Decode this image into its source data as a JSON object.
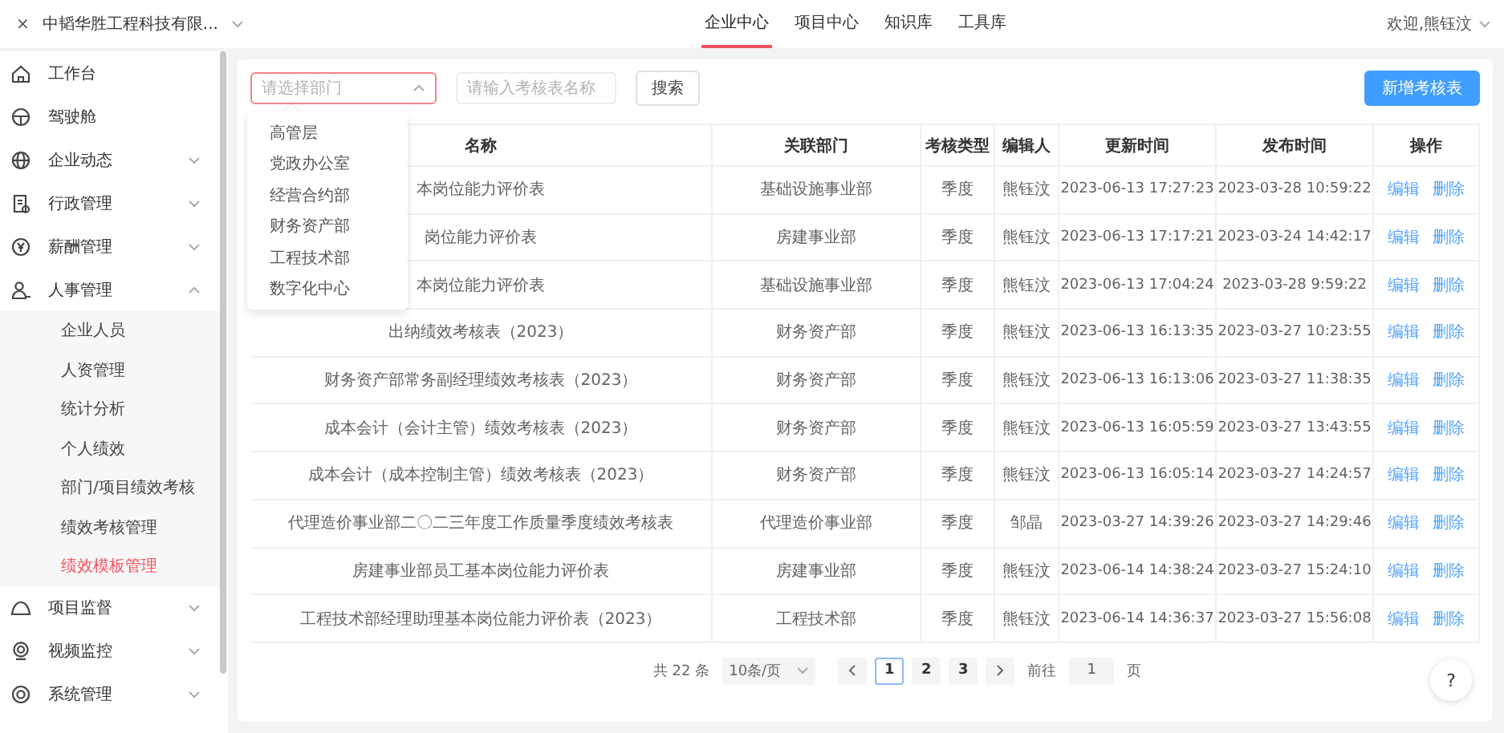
{
  "header": {
    "close": "×",
    "company": "中韬华胜工程科技有限...",
    "nav": [
      {
        "label": "企业中心",
        "selected": true
      },
      {
        "label": "项目中心",
        "selected": false
      },
      {
        "label": "知识库",
        "selected": false
      },
      {
        "label": "工具库",
        "selected": false
      }
    ],
    "user": "欢迎,熊钰汶"
  },
  "sidebar": {
    "items": [
      {
        "label": "工作台",
        "kind": "link"
      },
      {
        "label": "驾驶舱",
        "kind": "link"
      },
      {
        "label": "企业动态",
        "kind": "group",
        "expanded": false
      },
      {
        "label": "行政管理",
        "kind": "group",
        "expanded": false
      },
      {
        "label": "薪酬管理",
        "kind": "group",
        "expanded": false
      },
      {
        "label": "人事管理",
        "kind": "group",
        "expanded": true,
        "children": [
          {
            "label": "企业人员",
            "selected": false
          },
          {
            "label": "人资管理",
            "selected": false
          },
          {
            "label": "统计分析",
            "selected": false
          },
          {
            "label": "个人绩效",
            "selected": false
          },
          {
            "label": "部门/项目绩效考核",
            "selected": false
          },
          {
            "label": "绩效考核管理",
            "selected": false
          },
          {
            "label": "绩效模板管理",
            "selected": true
          }
        ]
      },
      {
        "label": "项目监督",
        "kind": "group",
        "expanded": false
      },
      {
        "label": "视频监控",
        "kind": "group",
        "expanded": false
      },
      {
        "label": "系统管理",
        "kind": "group",
        "expanded": false
      }
    ]
  },
  "filters": {
    "department": {
      "placeholder": "请选择部门",
      "expanded": true,
      "options": [
        "高管层",
        "党政办公室",
        "经营合约部",
        "财务资产部",
        "工程技术部",
        "数字化中心"
      ]
    },
    "name": {
      "placeholder": "请输入考核表名称"
    },
    "search_button": "搜索",
    "add_button": "新增考核表"
  },
  "table": {
    "columns": [
      "名称",
      "关联部门",
      "考核类型",
      "编辑人",
      "更新时间",
      "发布时间",
      "操作"
    ],
    "rows": [
      {
        "name": "本岗位能力评价表",
        "department": "基础设施事业部",
        "type": "季度",
        "editor": "熊钰汶",
        "updated": "2023-06-13 17:27:23",
        "published": "2023-03-28 10:59:22",
        "actions": [
          "编辑",
          "删除"
        ]
      },
      {
        "name": "岗位能力评价表",
        "department": "房建事业部",
        "type": "季度",
        "editor": "熊钰汶",
        "updated": "2023-06-13 17:17:21",
        "published": "2023-03-24 14:42:17",
        "actions": [
          "编辑",
          "删除"
        ]
      },
      {
        "name": "本岗位能力评价表",
        "department": "基础设施事业部",
        "type": "季度",
        "editor": "熊钰汶",
        "updated": "2023-06-13 17:04:24",
        "published": "2023-03-28 9:59:22",
        "actions": [
          "编辑",
          "删除"
        ]
      },
      {
        "name": "出纳绩效考核表（2023）",
        "department": "财务资产部",
        "type": "季度",
        "editor": "熊钰汶",
        "updated": "2023-06-13 16:13:35",
        "published": "2023-03-27 10:23:55",
        "actions": [
          "编辑",
          "删除"
        ]
      },
      {
        "name": "财务资产部常务副经理绩效考核表（2023）",
        "department": "财务资产部",
        "type": "季度",
        "editor": "熊钰汶",
        "updated": "2023-06-13 16:13:06",
        "published": "2023-03-27 11:38:35",
        "actions": [
          "编辑",
          "删除"
        ]
      },
      {
        "name": "成本会计（会计主管）绩效考核表（2023）",
        "department": "财务资产部",
        "type": "季度",
        "editor": "熊钰汶",
        "updated": "2023-06-13 16:05:59",
        "published": "2023-03-27 13:43:55",
        "actions": [
          "编辑",
          "删除"
        ]
      },
      {
        "name": "成本会计（成本控制主管）绩效考核表（2023）",
        "department": "财务资产部",
        "type": "季度",
        "editor": "熊钰汶",
        "updated": "2023-06-13 16:05:14",
        "published": "2023-03-27 14:24:57",
        "actions": [
          "编辑",
          "删除"
        ]
      },
      {
        "name": "代理造价事业部二〇二三年度工作质量季度绩效考核表",
        "department": "代理造价事业部",
        "type": "季度",
        "editor": "邹晶",
        "updated": "2023-03-27 14:39:26",
        "published": "2023-03-27 14:29:46",
        "actions": [
          "编辑",
          "删除"
        ]
      },
      {
        "name": "房建事业部员工基本岗位能力评价表",
        "department": "房建事业部",
        "type": "季度",
        "editor": "熊钰汶",
        "updated": "2023-06-14 14:38:24",
        "published": "2023-03-27 15:24:10",
        "actions": [
          "编辑",
          "删除"
        ]
      },
      {
        "name": "工程技术部经理助理基本岗位能力评价表（2023）",
        "department": "工程技术部",
        "type": "季度",
        "editor": "熊钰汶",
        "updated": "2023-06-14 14:36:37",
        "published": "2023-03-27 15:56:08",
        "actions": [
          "编辑",
          "删除"
        ]
      }
    ]
  },
  "pagination": {
    "total": "共 22 条",
    "page_size": "10条/页",
    "pages": [
      {
        "label": "1",
        "selected": true
      },
      {
        "label": "2",
        "selected": false
      },
      {
        "label": "3",
        "selected": false
      }
    ],
    "goto_label": "前往",
    "goto_value": "1",
    "goto_suffix": "页"
  },
  "help": "?"
}
